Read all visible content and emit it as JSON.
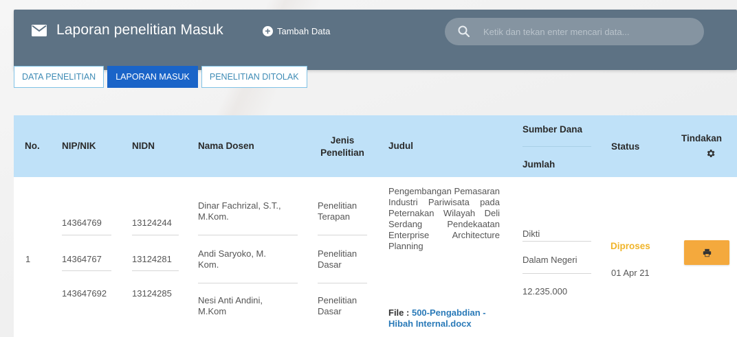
{
  "header": {
    "title": "Laporan penelitian Masuk",
    "add_label": "Tambah Data",
    "search_placeholder": "Ketik dan tekan enter mencari data..."
  },
  "tabs": [
    {
      "label": "DATA PENELITIAN",
      "active": false
    },
    {
      "label": "LAPORAN MASUK",
      "active": true
    },
    {
      "label": "PENELITIAN DITOLAK",
      "active": false
    }
  ],
  "table": {
    "headers": {
      "no": "No.",
      "nip": "NIP/NIK",
      "nidn": "NIDN",
      "nama": "Nama Dosen",
      "jenis_line1": "Jenis",
      "jenis_line2": "Penelitian",
      "judul": "Judul",
      "sumber": "Sumber Dana",
      "jumlah": "Jumlah",
      "status": "Status",
      "tindakan": "Tindakan"
    },
    "rows": [
      {
        "no": "1",
        "nip": [
          "14364769",
          "14364767",
          "143647692"
        ],
        "nidn": [
          "13124244",
          "13124281",
          "13124285"
        ],
        "nama": [
          "Dinar Fachrizal, S.T., M.Kom.",
          "Andi Saryoko, M. Kom.",
          "Nesi Anti Andini, M.Kom"
        ],
        "jenis": [
          "Penelitian Terapan",
          "Penelitian Dasar",
          "Penelitian Dasar"
        ],
        "judul": "Pengembangan Pemasaran Industri Pariwisata pada Peternakan Wilayah Deli Serdang Pendekaatan Enterprise Architecture Planning",
        "file_label": "File :",
        "file_name": "500-Pengabdian - Hibah Internal.docx",
        "sumber": "Dikti",
        "sumber_kategori": "Dalam Negeri",
        "jumlah": "12.235.000",
        "status": "Diproses",
        "date": "01 Apr 21"
      }
    ]
  },
  "colors": {
    "header_bg": "#5d7284",
    "table_header_bg": "#bfe1f8",
    "tab_active": "#1a64c8",
    "status_processing": "#f0b429",
    "action_button": "#f4a93d"
  },
  "icons": {
    "mail": "mail-icon",
    "add": "plus-circle-icon",
    "search": "search-icon",
    "settings": "gear-icon",
    "print": "print-icon"
  }
}
